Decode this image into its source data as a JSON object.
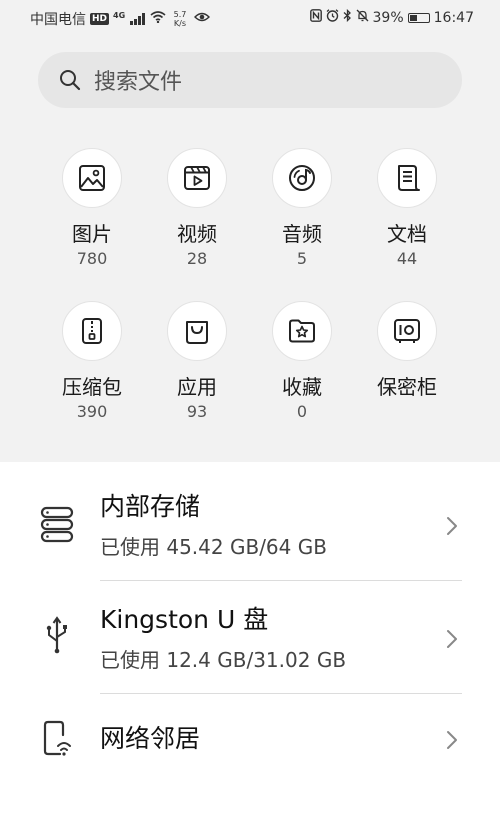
{
  "status_bar": {
    "carrier": "中国电信",
    "hd": "HD",
    "network": "4G",
    "speed_value": "5.7",
    "speed_unit": "K/s",
    "battery": "39%",
    "battery_level": 0.39,
    "time": "16:47"
  },
  "search": {
    "placeholder": "搜索文件",
    "icon": "search-icon"
  },
  "categories": [
    {
      "label": "图片",
      "count": "780",
      "icon": "image-icon"
    },
    {
      "label": "视频",
      "count": "28",
      "icon": "video-icon"
    },
    {
      "label": "音频",
      "count": "5",
      "icon": "music-disc-icon"
    },
    {
      "label": "文档",
      "count": "44",
      "icon": "document-icon"
    },
    {
      "label": "压缩包",
      "count": "390",
      "icon": "zip-icon"
    },
    {
      "label": "应用",
      "count": "93",
      "icon": "app-bag-icon"
    },
    {
      "label": "收藏",
      "count": "0",
      "icon": "favorite-folder-icon"
    },
    {
      "label": "保密柜",
      "count": "",
      "icon": "safe-icon"
    }
  ],
  "storage": [
    {
      "title": "内部存储",
      "subtitle": "已使用 45.42 GB/64 GB",
      "icon": "storage-icon"
    },
    {
      "title": "Kingston U 盘",
      "subtitle": "已使用 12.4 GB/31.02 GB",
      "icon": "usb-icon"
    },
    {
      "title": "网络邻居",
      "subtitle": "",
      "icon": "network-device-icon"
    }
  ]
}
